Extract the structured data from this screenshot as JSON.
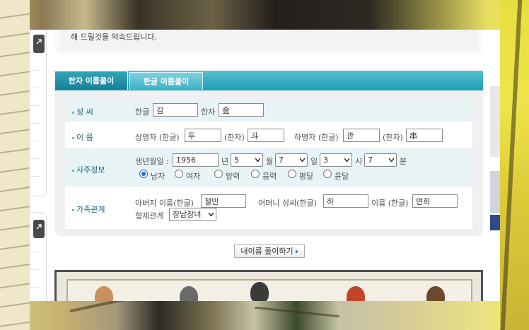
{
  "notice": {
    "text": "해 드릴것을 약속드립니다."
  },
  "tabs": [
    {
      "label": "한자 이름풀이",
      "active": true
    },
    {
      "label": "한글 이름풀이",
      "active": false
    }
  ],
  "form": {
    "surname": {
      "label": "성 씨",
      "hangul_label": "한글",
      "hangul_value": "김",
      "hanja_label": "한자",
      "hanja_value": "金"
    },
    "name": {
      "label": "이 름",
      "upper_label": "상명자 (한글)",
      "upper_value": "두",
      "upper_hanja_label": "(한자)",
      "upper_hanja_value": "斗",
      "lower_label": "하명자 (한글)",
      "lower_value": "관",
      "lower_hanja_label": "(한자)",
      "lower_hanja_value": "串"
    },
    "saju": {
      "label": "사주정보",
      "birth_label": "생년월일 :",
      "year_value": "1956",
      "year_unit": "년",
      "month_value": "5",
      "month_unit": "월",
      "day_value": "7",
      "day_unit": "일",
      "hour_value": "3",
      "hour_unit": "시",
      "minute_value": "7",
      "minute_unit": "분",
      "gender_options": [
        "남자",
        "여자"
      ],
      "gender_selected": "남자",
      "calendar_options": [
        "양력",
        "음력"
      ],
      "leap_options": [
        "평달",
        "윤달"
      ]
    },
    "family": {
      "label": "가족관계",
      "father_label": "아버지 이름(한글)",
      "father_value": "철민",
      "mother_surname_label": "어머니 성씨(한글)",
      "mother_surname_value": "하",
      "mother_name_label": "이름 (한글)",
      "mother_name_value": "연희",
      "sibling_label": "형제관계",
      "sibling_value": "장남장녀"
    }
  },
  "submit": {
    "label": "내이름 풀이하기"
  },
  "colors": {
    "accent": "#1d9fb7",
    "label_text": "#1b6a7a",
    "row_shade": "#e8f3f6",
    "radio_selected": "#1a6fd6"
  }
}
